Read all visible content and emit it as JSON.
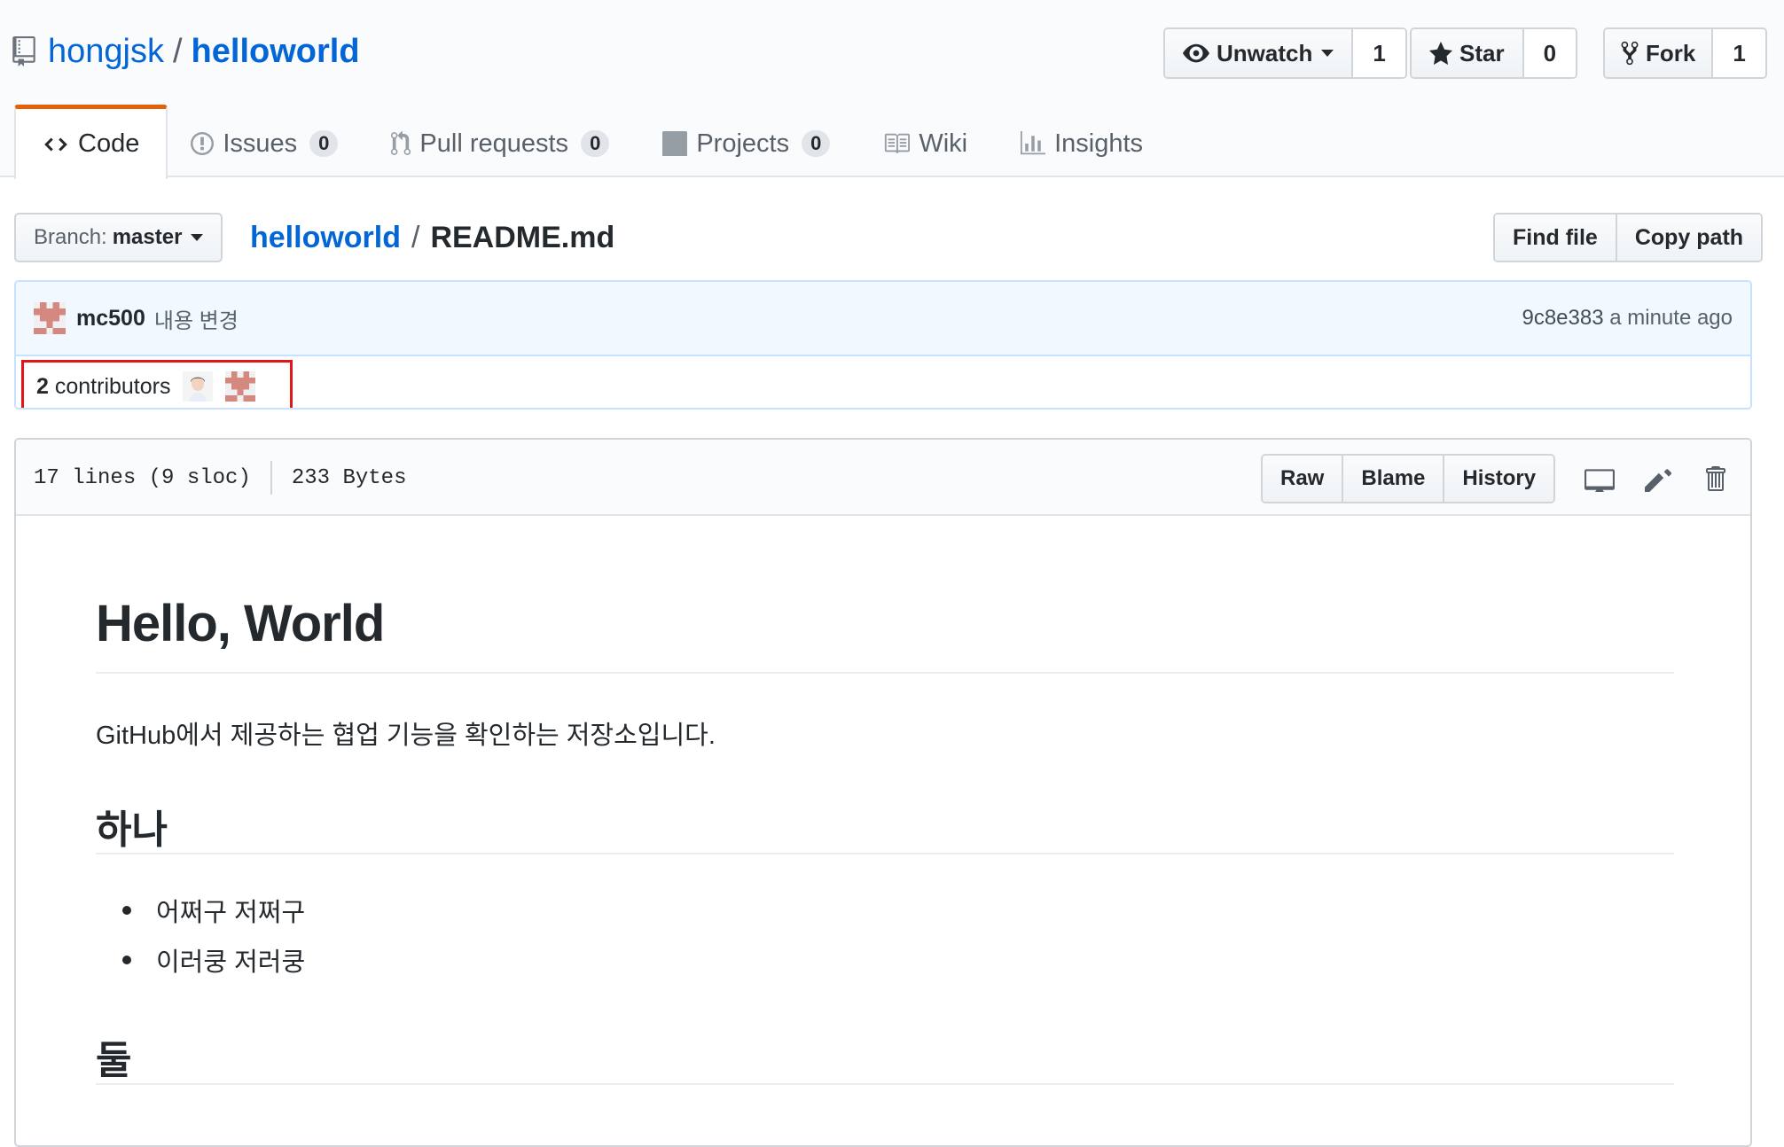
{
  "repo": {
    "owner": "hongjsk",
    "separator": "/",
    "name": "helloworld"
  },
  "actions": {
    "watch": {
      "label": "Unwatch",
      "count": "1"
    },
    "star": {
      "label": "Star",
      "count": "0"
    },
    "fork": {
      "label": "Fork",
      "count": "1"
    }
  },
  "tabs": [
    {
      "label": "Code",
      "counter": ""
    },
    {
      "label": "Issues",
      "counter": "0"
    },
    {
      "label": "Pull requests",
      "counter": "0"
    },
    {
      "label": "Projects",
      "counter": "0"
    },
    {
      "label": "Wiki",
      "counter": ""
    },
    {
      "label": "Insights",
      "counter": ""
    }
  ],
  "file_nav": {
    "branch_prefix": "Branch:",
    "branch": "master",
    "breadcrumb_repo": "helloworld",
    "breadcrumb_sep": "/",
    "breadcrumb_file": "README.md",
    "find_file": "Find file",
    "copy_path": "Copy path"
  },
  "commit": {
    "author": "mc500",
    "message": "내용 변경",
    "sha": "9c8e383",
    "time": "a minute ago"
  },
  "contributors": {
    "count": "2",
    "label": "contributors"
  },
  "file": {
    "lines": "17 lines (9 sloc)",
    "size": "233 Bytes",
    "raw": "Raw",
    "blame": "Blame",
    "history": "History"
  },
  "readme": {
    "h1": "Hello, World",
    "intro": "GitHub에서 제공하는 협업 기능을 확인하는 저장소입니다.",
    "h2_one": "하나",
    "items": [
      "어쩌구 저쩌구",
      "이러쿵 저러쿵"
    ],
    "h2_two": "둘"
  },
  "colors": {
    "link": "#0366d6",
    "tab_accent": "#e36209",
    "highlight_box": "#e0161b",
    "commit_bg": "#f1f8ff"
  }
}
